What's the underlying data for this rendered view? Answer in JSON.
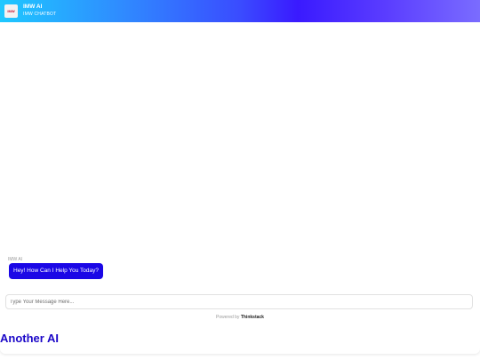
{
  "header": {
    "avatar_text": "IMW",
    "title": "IMW AI",
    "subtitle": "IMW CHATBOT"
  },
  "conversation": {
    "bot_name": "IMW AI",
    "greeting": "Hey! How Can I Help You Today?"
  },
  "composer": {
    "placeholder": "Type Your Message Here...",
    "value": ""
  },
  "footer": {
    "powered_prefix": "Powered by",
    "brand": "Thinkstack"
  },
  "section": {
    "heading": "Another AI"
  },
  "colors": {
    "accent": "#1b07e6",
    "heading": "#1b07c8"
  }
}
